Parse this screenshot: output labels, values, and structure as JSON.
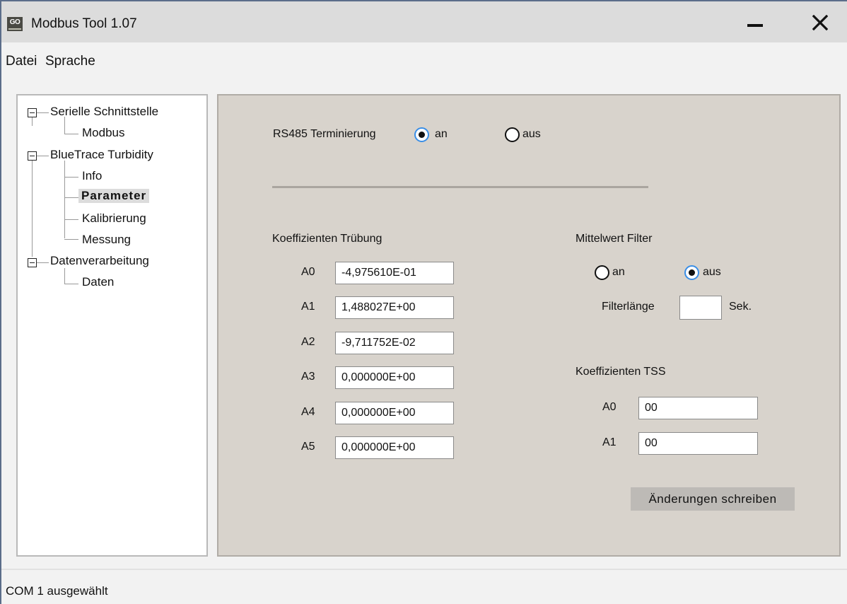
{
  "window": {
    "title": "Modbus Tool 1.07",
    "logo": "GO"
  },
  "menu": {
    "items": [
      "Datei",
      "Sprache"
    ]
  },
  "tree": {
    "nodes": [
      {
        "label": "Serielle Schnittstelle",
        "expanded": true
      },
      {
        "label": "Modbus"
      },
      {
        "label": "BlueTrace Turbidity",
        "expanded": true
      },
      {
        "label": "Info"
      },
      {
        "label": "Parameter",
        "selected": true
      },
      {
        "label": "Kalibrierung"
      },
      {
        "label": "Messung"
      },
      {
        "label": "Datenverarbeitung",
        "expanded": true
      },
      {
        "label": "Daten"
      }
    ]
  },
  "panel": {
    "termination": {
      "label": "RS485 Terminierung",
      "on": "an",
      "off": "aus",
      "selected": "an"
    },
    "turbidity": {
      "heading": "Koeffizienten Trübung",
      "rows": [
        {
          "label": "A0",
          "value": "-4,975610E-01"
        },
        {
          "label": "A1",
          "value": "1,488027E+00"
        },
        {
          "label": "A2",
          "value": "-9,711752E-02"
        },
        {
          "label": "A3",
          "value": "0,000000E+00"
        },
        {
          "label": "A4",
          "value": "0,000000E+00"
        },
        {
          "label": "A5",
          "value": "0,000000E+00"
        }
      ]
    },
    "filter": {
      "heading": "Mittelwert Filter",
      "on": "an",
      "off": "aus",
      "selected": "aus",
      "length_label": "Filterlänge",
      "length_value": "",
      "unit": "Sek."
    },
    "tss": {
      "heading": "Koeffizienten TSS",
      "rows": [
        {
          "label": "A0",
          "value": "00"
        },
        {
          "label": "A1",
          "value": "00"
        }
      ]
    },
    "write_button": "Änderungen schreiben"
  },
  "status": {
    "text": "COM 1 ausgewählt"
  },
  "colors": {
    "accent": "#3a8ee6",
    "panel": "#d8d3cc",
    "titlebar": "#dcdcdc"
  }
}
